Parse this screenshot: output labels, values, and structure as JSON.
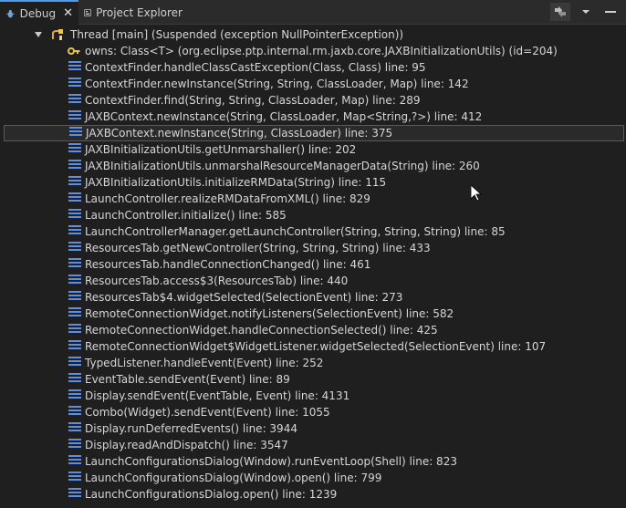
{
  "tabs": [
    {
      "label": "Debug",
      "icon": "debug-bug-icon",
      "active": true,
      "closable": true
    },
    {
      "label": "Project Explorer",
      "icon": "project-explorer-icon",
      "active": false,
      "closable": false
    }
  ],
  "toolbar": {
    "icons": [
      "minimize-view-icon",
      "view-menu-icon"
    ]
  },
  "thread": {
    "label": "Thread [main] (Suspended (exception NullPointerException))",
    "icon": "thread-icon"
  },
  "owns": {
    "label": "owns: Class<T>  (org.eclipse.ptp.internal.rm.jaxb.core.JAXBInitializationUtils) (id=204)",
    "icon": "key-icon"
  },
  "frames": [
    "ContextFinder.handleClassCastException(Class, Class) line: 95",
    "ContextFinder.newInstance(String, String, ClassLoader, Map) line: 142",
    "ContextFinder.find(String, String, ClassLoader, Map) line: 289",
    "JAXBContext.newInstance(String, ClassLoader, Map<String,?>) line: 412",
    "JAXBContext.newInstance(String, ClassLoader) line: 375",
    "JAXBInitializationUtils.getUnmarshaller() line: 202",
    "JAXBInitializationUtils.unmarshalResourceManagerData(String) line: 260",
    "JAXBInitializationUtils.initializeRMData(String) line: 115",
    "LaunchController.realizeRMDataFromXML() line: 829",
    "LaunchController.initialize() line: 585",
    "LaunchControllerManager.getLaunchController(String, String, String) line: 85",
    "ResourcesTab.getNewController(String, String, String) line: 433",
    "ResourcesTab.handleConnectionChanged() line: 461",
    "ResourcesTab.access$3(ResourcesTab) line: 440",
    "ResourcesTab$4.widgetSelected(SelectionEvent) line: 273",
    "RemoteConnectionWidget.notifyListeners(SelectionEvent) line: 582",
    "RemoteConnectionWidget.handleConnectionSelected() line: 425",
    "RemoteConnectionWidget$WidgetListener.widgetSelected(SelectionEvent) line: 107",
    "TypedListener.handleEvent(Event) line: 252",
    "EventTable.sendEvent(Event) line: 89",
    "Display.sendEvent(EventTable, Event) line: 4131",
    "Combo(Widget).sendEvent(Event) line: 1055",
    "Display.runDeferredEvents() line: 3944",
    "Display.readAndDispatch() line: 3547",
    "LaunchConfigurationsDialog(Window).runEventLoop(Shell) line: 823",
    "LaunchConfigurationsDialog(Window).open() line: 799",
    "LaunchConfigurationsDialog.open() line: 1239"
  ],
  "selected_index": 4,
  "colors": {
    "background": "#1f1f1f",
    "text": "#d6d6d6",
    "frame_icon": "#5b8ee6",
    "tab_accent": "#4d9be8",
    "selection": "#2a2a2a"
  }
}
